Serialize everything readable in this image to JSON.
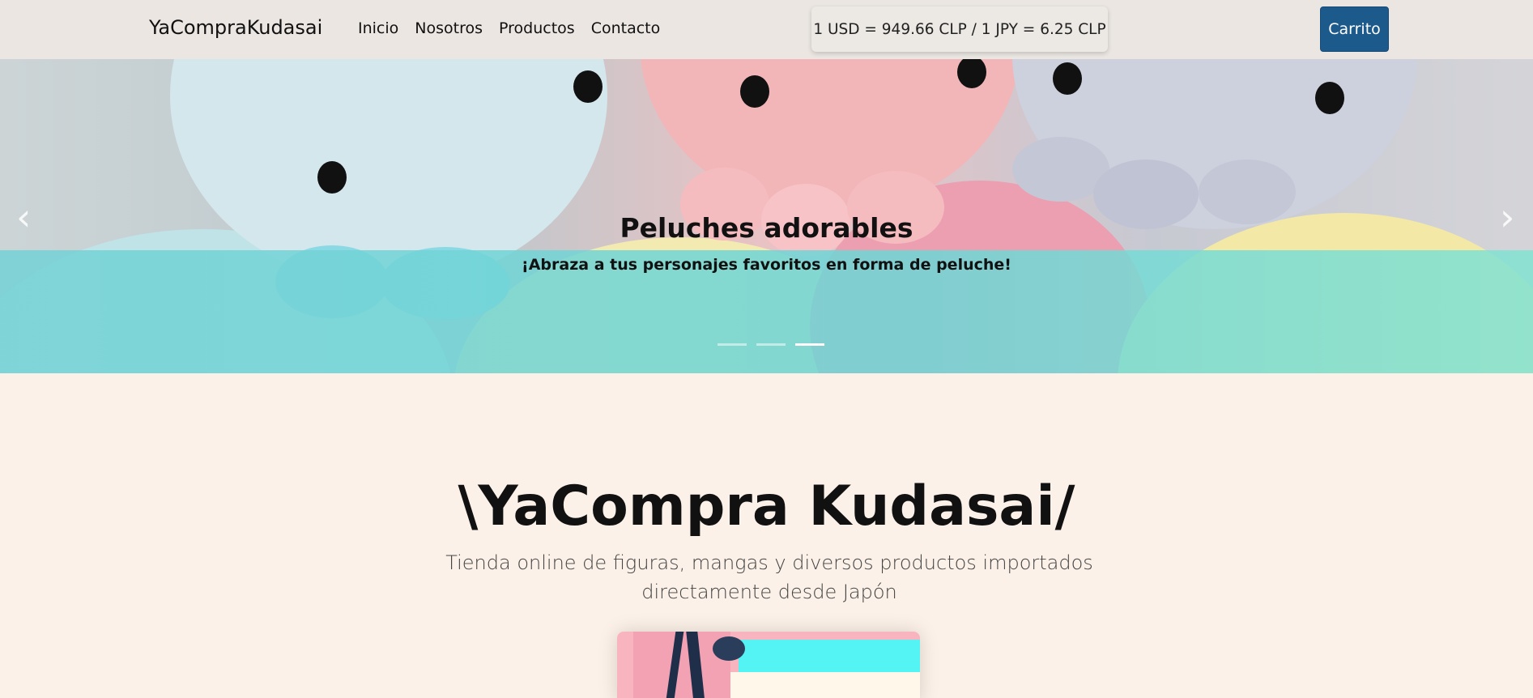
{
  "navbar": {
    "brand": "YaCompraKudasai",
    "links": [
      "Inicio",
      "Nosotros",
      "Productos",
      "Contacto"
    ],
    "exchange_rate": "1 USD = 949.66 CLP / 1 JPY = 6.25 CLP",
    "cart_label": "Carrito"
  },
  "carousel": {
    "title": "Peluches adorables",
    "subtitle": "¡Abraza a tus personajes favoritos en forma de peluche!",
    "prev_icon": "chevron-left-icon",
    "next_icon": "chevron-right-icon",
    "slide_count": 3,
    "active_slide": 3
  },
  "main": {
    "title": "\\YaCompra Kudasai/",
    "lead": "Tienda online de figuras, mangas y diversos productos importados directamente desde Japón"
  },
  "colors": {
    "navbar_bg": "#ebe6e2",
    "page_bg": "#fbf1e8",
    "cart_button": "#1d5a8c",
    "caption_band": "#74d2d6"
  }
}
